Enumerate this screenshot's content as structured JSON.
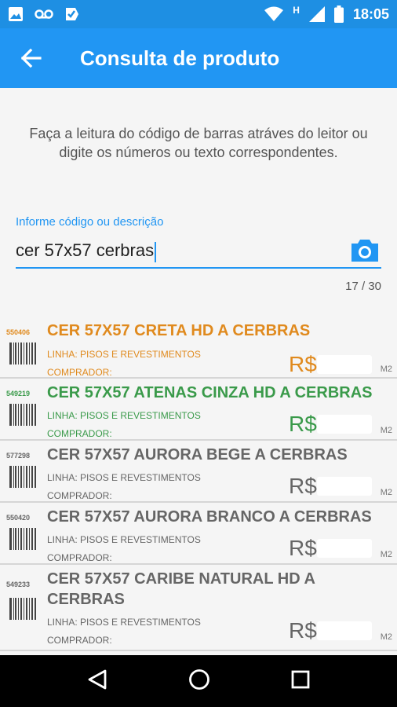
{
  "status_bar": {
    "time": "18:05",
    "network_label": "H",
    "left_icons": [
      "image-icon",
      "voicemail-icon",
      "check-icon"
    ],
    "right_icons": [
      "wifi-icon",
      "signal-icon",
      "battery-icon"
    ]
  },
  "app_bar": {
    "title": "Consulta de produto",
    "back_icon": "arrow-back-icon"
  },
  "instructions": "Faça a leitura do código de barras atráves do leitor ou digite os números ou texto correspondentes.",
  "search": {
    "label": "Informe código ou descrição",
    "value": "cer 57x57 cerbras",
    "counter": "17 / 30",
    "camera_icon": "camera-icon"
  },
  "colors": {
    "primary": "#2196f3",
    "status_bar": "#1e8fe3",
    "orange": "#e08a1e",
    "green": "#3a9a4a",
    "gray_text": "#666666"
  },
  "products": [
    {
      "code": "550406",
      "name": "CER 57X57  CRETA HD A CERBRAS",
      "linha": "LINHA: PISOS E REVESTIMENTOS",
      "comprador": "COMPRADOR:",
      "price": "R$",
      "unit": "M2",
      "color": "#e08a1e"
    },
    {
      "code": "549219",
      "name": "CER 57X57 ATENAS CINZA HD A CERBRAS",
      "linha": "LINHA: PISOS E REVESTIMENTOS",
      "comprador": "COMPRADOR:",
      "price": "R$",
      "unit": "M2",
      "color": "#3a9a4a"
    },
    {
      "code": "577298",
      "name": "CER 57X57 AURORA BEGE A CERBRAS",
      "linha": "LINHA: PISOS E REVESTIMENTOS",
      "comprador": "COMPRADOR:",
      "price": "R$",
      "unit": "M2",
      "color": "#666666"
    },
    {
      "code": "550420",
      "name": "CER 57X57 AURORA BRANCO A CERBRAS",
      "linha": "LINHA: PISOS E REVESTIMENTOS",
      "comprador": "COMPRADOR:",
      "price": "R$",
      "unit": "M2",
      "color": "#666666"
    },
    {
      "code": "549233",
      "name": "CER 57X57 CARIBE NATURAL HD A CERBRAS",
      "linha": "LINHA: PISOS E REVESTIMENTOS",
      "comprador": "COMPRADOR:",
      "price": "R$",
      "unit": "M2",
      "color": "#666666"
    }
  ],
  "nav_bar": {
    "icons": [
      "back-triangle-icon",
      "home-circle-icon",
      "recents-square-icon"
    ]
  }
}
